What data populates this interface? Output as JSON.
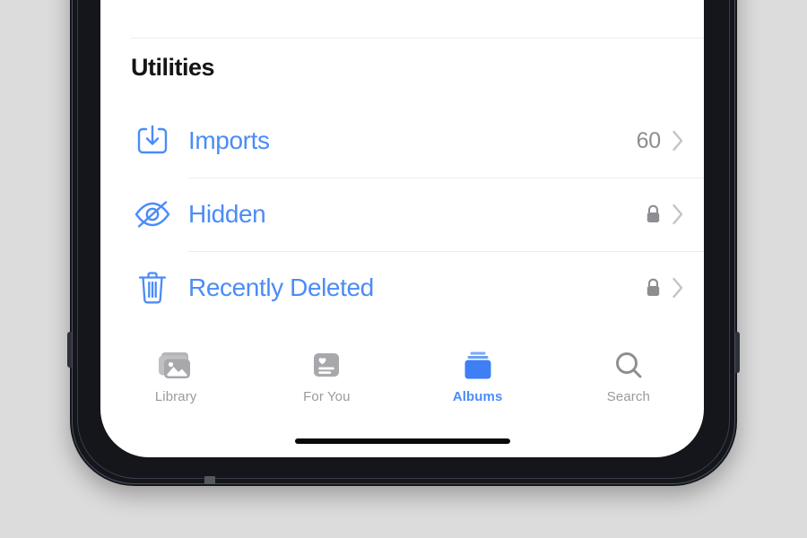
{
  "device": {
    "frame_color": "#14161c",
    "screen_background": "#ffffff",
    "page_background": "#dcdcdc"
  },
  "colors": {
    "accent_blue": "#4b8cf7",
    "secondary_gray": "#8d8d92",
    "tab_inactive": "#9a9a9e",
    "separator": "#ececec",
    "heading": "#151515"
  },
  "list": {
    "section_title": "Utilities",
    "rows": [
      {
        "label": "Imports",
        "icon": "import-tray-icon",
        "value": "60",
        "accessory": "chevron-right-icon",
        "locked": false
      },
      {
        "label": "Hidden",
        "icon": "eye-slash-icon",
        "value": "",
        "accessory": "chevron-right-icon",
        "locked": true,
        "lock_icon": "lock-icon"
      },
      {
        "label": "Recently Deleted",
        "icon": "trash-icon",
        "value": "",
        "accessory": "chevron-right-icon",
        "locked": true,
        "lock_icon": "lock-icon"
      }
    ]
  },
  "tabbar": {
    "tabs": [
      {
        "label": "Library",
        "icon": "photo-stack-icon",
        "active": false
      },
      {
        "label": "For You",
        "icon": "for-you-card-icon",
        "active": false
      },
      {
        "label": "Albums",
        "icon": "albums-stack-icon",
        "active": true
      },
      {
        "label": "Search",
        "icon": "magnifier-icon",
        "active": false
      }
    ]
  }
}
